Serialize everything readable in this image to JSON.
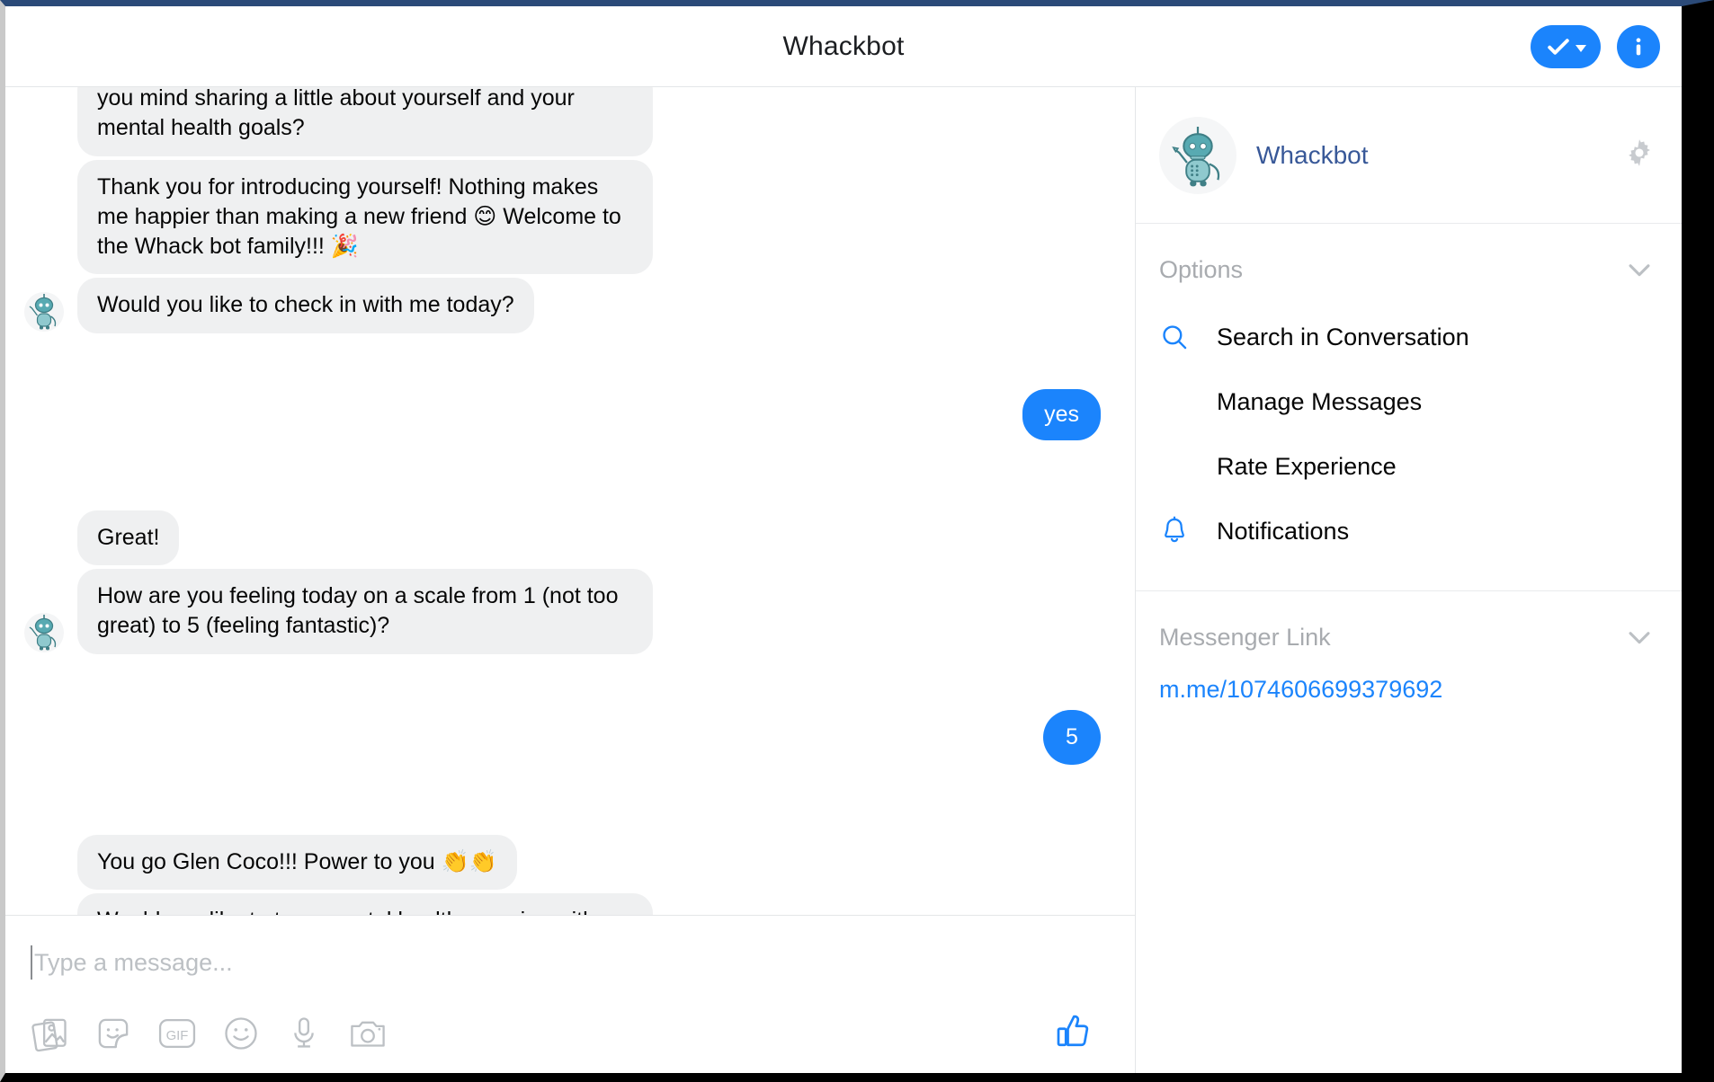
{
  "window": {
    "accent_blue": "#1b84fc",
    "bot_bubble_bg": "#eff0f1",
    "title_bar_color": "#2b4a78"
  },
  "header": {
    "title": "Whackbot",
    "done_button_label": "",
    "done_icon": "check-icon",
    "dropdown_icon": "caret-down-icon",
    "info_icon": "info-icon"
  },
  "conversation": {
    "messages": [
      {
        "sender": "bot",
        "text": "you mind sharing a little about yourself and your mental health goals?",
        "clipped_top": true,
        "avatar": false
      },
      {
        "sender": "bot",
        "text": "Thank you for introducing yourself! Nothing makes me happier than making a new friend 😊 Welcome to the Whack bot family!!! 🎉",
        "avatar": false
      },
      {
        "sender": "bot",
        "text": "Would you like to check in with me today?",
        "avatar": true
      },
      {
        "sender": "me",
        "text": "yes"
      },
      {
        "sender": "bot",
        "text": "Great!",
        "avatar": false
      },
      {
        "sender": "bot",
        "text": "How are you feeling today on a scale from 1 (not too great) to 5 (feeling fantastic)?",
        "avatar": true
      },
      {
        "sender": "me",
        "text": "5"
      },
      {
        "sender": "bot",
        "text": "You go Glen Coco!!! Power to you 👏👏",
        "avatar": false
      },
      {
        "sender": "bot",
        "text": "Would you like to try a mental health exercise with me today?",
        "avatar": true
      }
    ],
    "seen_indicator": "seen-avatar"
  },
  "composer": {
    "placeholder": "Type a message...",
    "value": "",
    "tools": [
      {
        "name": "photo-icon",
        "label": "Photos"
      },
      {
        "name": "sticker-icon",
        "label": "Stickers"
      },
      {
        "name": "gif-icon",
        "label": "GIF"
      },
      {
        "name": "emoji-icon",
        "label": "Emoji"
      },
      {
        "name": "microphone-icon",
        "label": "Voice"
      },
      {
        "name": "camera-icon",
        "label": "Camera"
      }
    ],
    "gif_label": "GIF",
    "like_icon": "thumbs-up-icon"
  },
  "sidebar": {
    "profile": {
      "name": "Whackbot",
      "avatar": "whackbot-avatar",
      "settings_icon": "gear-icon"
    },
    "sections": [
      {
        "title": "Options",
        "chevron": "chevron-down-icon",
        "items": [
          {
            "label": "Search in Conversation",
            "icon": "search-icon"
          },
          {
            "label": "Manage Messages",
            "icon": ""
          },
          {
            "label": "Rate Experience",
            "icon": ""
          },
          {
            "label": "Notifications",
            "icon": "bell-icon"
          }
        ]
      },
      {
        "title": "Messenger Link",
        "chevron": "chevron-down-icon",
        "link": "m.me/1074606699379692"
      }
    ]
  }
}
